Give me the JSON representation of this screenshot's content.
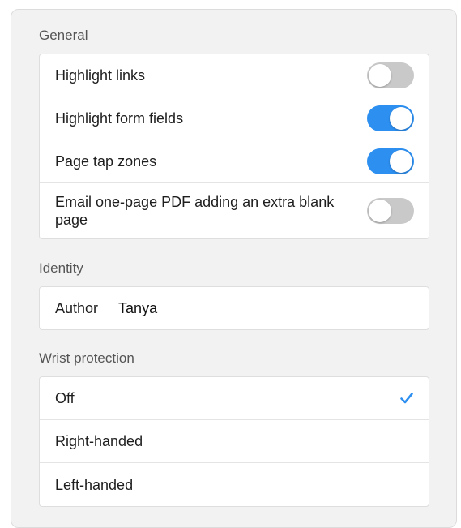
{
  "general": {
    "header": "General",
    "rows": [
      {
        "label": "Highlight links",
        "enabled": false
      },
      {
        "label": "Highlight form fields",
        "enabled": true
      },
      {
        "label": "Page tap zones",
        "enabled": true
      },
      {
        "label": "Email one-page PDF adding an extra blank page",
        "enabled": false
      }
    ]
  },
  "identity": {
    "header": "Identity",
    "author_label": "Author",
    "author_value": "Tanya"
  },
  "wrist_protection": {
    "header": "Wrist protection",
    "options": [
      {
        "label": "Off",
        "selected": true
      },
      {
        "label": "Right-handed",
        "selected": false
      },
      {
        "label": "Left-handed",
        "selected": false
      }
    ]
  },
  "colors": {
    "toggle_on": "#2d8ff0",
    "toggle_off": "#c9c9c9",
    "checkmark": "#2d8ff0"
  }
}
